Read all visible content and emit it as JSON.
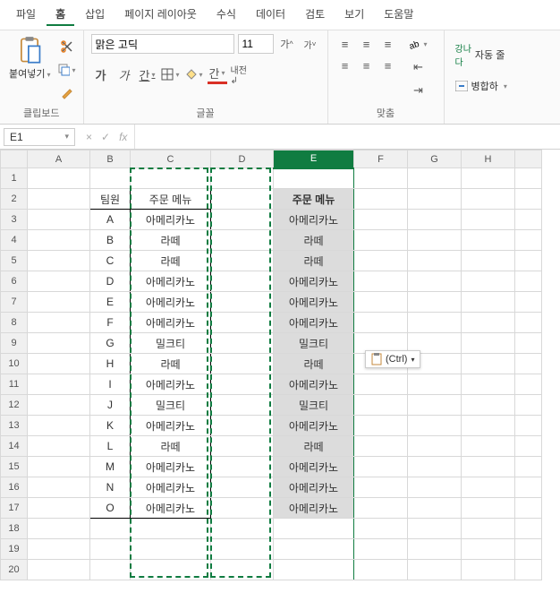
{
  "menu": [
    "파일",
    "홈",
    "삽입",
    "페이지 레이아웃",
    "수식",
    "데이터",
    "검토",
    "보기",
    "도움말"
  ],
  "menu_active": 1,
  "ribbon": {
    "clipboard": {
      "paste": "붙여넣기",
      "group": "클립보드"
    },
    "font": {
      "name": "맑은 고딕",
      "size": "11",
      "inc": "가^",
      "dec": "가˅",
      "bold": "가",
      "italic": "가",
      "under": "간",
      "border": "▦",
      "fill": "◆",
      "color": "간",
      "wrap": "내전 ↲",
      "group": "글꼴"
    },
    "align": {
      "group": "맞춤",
      "wrap": "자동 줄",
      "merge": "병합하"
    },
    "alignIcons": {
      "tl": "≡",
      "tc": "≡",
      "tr": "≡",
      "bl": "≡",
      "bc": "≡",
      "br": "≡"
    }
  },
  "namebox": "E1",
  "fx": {
    "cancel": "×",
    "confirm": "✓",
    "fx": "fx"
  },
  "cols": [
    "A",
    "B",
    "C",
    "D",
    "E",
    "F",
    "G",
    "H",
    ""
  ],
  "selected_col": "E",
  "rows": 20,
  "table": {
    "hdr_team": "팀원",
    "hdr_menu": "주문 메뉴",
    "rows": [
      {
        "t": "A",
        "m": "아메리카노"
      },
      {
        "t": "B",
        "m": "라떼"
      },
      {
        "t": "C",
        "m": "라떼"
      },
      {
        "t": "D",
        "m": "아메리카노"
      },
      {
        "t": "E",
        "m": "아메리카노"
      },
      {
        "t": "F",
        "m": "아메리카노"
      },
      {
        "t": "G",
        "m": "밀크티"
      },
      {
        "t": "H",
        "m": "라떼"
      },
      {
        "t": "I",
        "m": "아메리카노"
      },
      {
        "t": "J",
        "m": "밀크티"
      },
      {
        "t": "K",
        "m": "아메리카노"
      },
      {
        "t": "L",
        "m": "라떼"
      },
      {
        "t": "M",
        "m": "아메리카노"
      },
      {
        "t": "N",
        "m": "아메리카노"
      },
      {
        "t": "O",
        "m": "아메리카노"
      }
    ]
  },
  "paste_opt": "(Ctrl)"
}
